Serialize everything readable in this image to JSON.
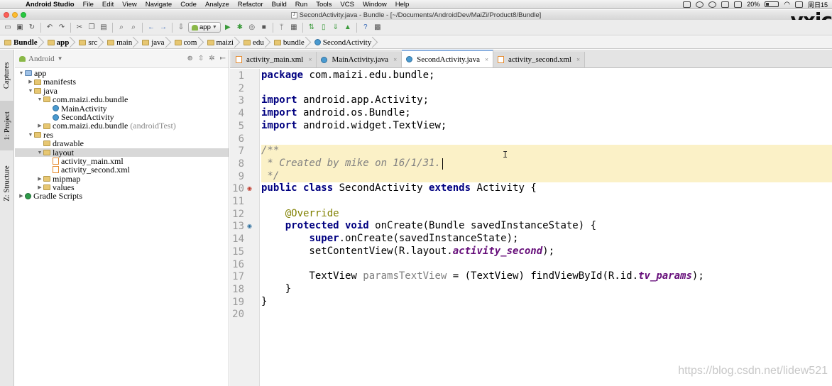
{
  "menubar": {
    "apple": "",
    "items": [
      "Android Studio",
      "File",
      "Edit",
      "View",
      "Navigate",
      "Code",
      "Analyze",
      "Refactor",
      "Build",
      "Run",
      "Tools",
      "VCS",
      "Window",
      "Help"
    ],
    "battery": "20%",
    "clock": "周日15"
  },
  "window": {
    "title": "SecondActivity.java - Bundle - [~/Documents/AndroidDev/MaiZi/Product8/Bundle]",
    "watermark": "vxic"
  },
  "toolbar": {
    "run_config": "app"
  },
  "breadcrumb": [
    "Bundle",
    "app",
    "src",
    "main",
    "java",
    "com",
    "maizi",
    "edu",
    "bundle",
    "SecondActivity"
  ],
  "left_tabs": [
    "Captures",
    "1: Project",
    "Z: Structure"
  ],
  "project": {
    "view_mode": "Android",
    "tree": [
      {
        "label": "app",
        "level": 0,
        "arrow": "open",
        "icon": "folder-blue"
      },
      {
        "label": "manifests",
        "level": 1,
        "arrow": "closed",
        "icon": "folder"
      },
      {
        "label": "java",
        "level": 1,
        "arrow": "open",
        "icon": "folder"
      },
      {
        "label": "com.maizi.edu.bundle",
        "level": 2,
        "arrow": "open",
        "icon": "pkg"
      },
      {
        "label": "MainActivity",
        "level": 3,
        "arrow": "",
        "icon": "cls"
      },
      {
        "label": "SecondActivity",
        "level": 3,
        "arrow": "",
        "icon": "cls"
      },
      {
        "label": "com.maizi.edu.bundle",
        "suffix": "(androidTest)",
        "level": 2,
        "arrow": "closed",
        "icon": "pkg"
      },
      {
        "label": "res",
        "level": 1,
        "arrow": "open",
        "icon": "folder"
      },
      {
        "label": "drawable",
        "level": 2,
        "arrow": "",
        "icon": "folder"
      },
      {
        "label": "layout",
        "level": 2,
        "arrow": "open",
        "icon": "folder",
        "selected": true
      },
      {
        "label": "activity_main.xml",
        "level": 3,
        "arrow": "",
        "icon": "xml"
      },
      {
        "label": "activity_second.xml",
        "level": 3,
        "arrow": "",
        "icon": "xml"
      },
      {
        "label": "mipmap",
        "level": 2,
        "arrow": "closed",
        "icon": "folder"
      },
      {
        "label": "values",
        "level": 2,
        "arrow": "closed",
        "icon": "folder"
      },
      {
        "label": "Gradle Scripts",
        "level": 0,
        "arrow": "closed",
        "icon": "gradle"
      }
    ]
  },
  "tabs": [
    {
      "label": "activity_main.xml",
      "icon": "xml",
      "active": false
    },
    {
      "label": "MainActivity.java",
      "icon": "cls",
      "active": false
    },
    {
      "label": "SecondActivity.java",
      "icon": "cls",
      "active": true
    },
    {
      "label": "activity_second.xml",
      "icon": "xml",
      "active": false
    }
  ],
  "editor": {
    "highlight_lines": [
      7,
      8,
      9
    ],
    "lines": [
      [
        {
          "t": "package",
          "c": "kw"
        },
        {
          "t": " com.maizi.edu.bundle;"
        }
      ],
      [],
      [
        {
          "t": "import",
          "c": "kw"
        },
        {
          "t": " android.app.Activity;"
        }
      ],
      [
        {
          "t": "import",
          "c": "kw"
        },
        {
          "t": " android.os.Bundle;"
        }
      ],
      [
        {
          "t": "import",
          "c": "kw"
        },
        {
          "t": " android.widget.TextView;"
        }
      ],
      [],
      [
        {
          "t": "/**",
          "c": "cmt"
        }
      ],
      [
        {
          "t": " * Created by mike on 16/1/31.",
          "c": "cmt"
        }
      ],
      [
        {
          "t": " */",
          "c": "cmt"
        }
      ],
      [
        {
          "t": "public class",
          "c": "kw"
        },
        {
          "t": " SecondActivity "
        },
        {
          "t": "extends",
          "c": "kw"
        },
        {
          "t": " Activity {"
        }
      ],
      [],
      [
        {
          "t": "    "
        },
        {
          "t": "@Override",
          "c": "ann"
        }
      ],
      [
        {
          "t": "    "
        },
        {
          "t": "protected void",
          "c": "kw"
        },
        {
          "t": " onCreate(Bundle savedInstanceState) {"
        }
      ],
      [
        {
          "t": "        "
        },
        {
          "t": "super",
          "c": "kw"
        },
        {
          "t": ".onCreate(savedInstanceState);"
        }
      ],
      [
        {
          "t": "        setContentView(R.layout."
        },
        {
          "t": "activity_second",
          "c": "fld"
        },
        {
          "t": ");"
        }
      ],
      [],
      [
        {
          "t": "        TextView "
        },
        {
          "t": "paramsTextView",
          "c": "unused"
        },
        {
          "t": " = (TextView) findViewById(R.id."
        },
        {
          "t": "tv_params",
          "c": "fld"
        },
        {
          "t": ");"
        }
      ],
      [
        {
          "t": "    }"
        }
      ],
      [
        {
          "t": "}"
        }
      ],
      []
    ]
  },
  "ibeam": "I",
  "csdn_watermark": "https://blog.csdn.net/lidew521"
}
